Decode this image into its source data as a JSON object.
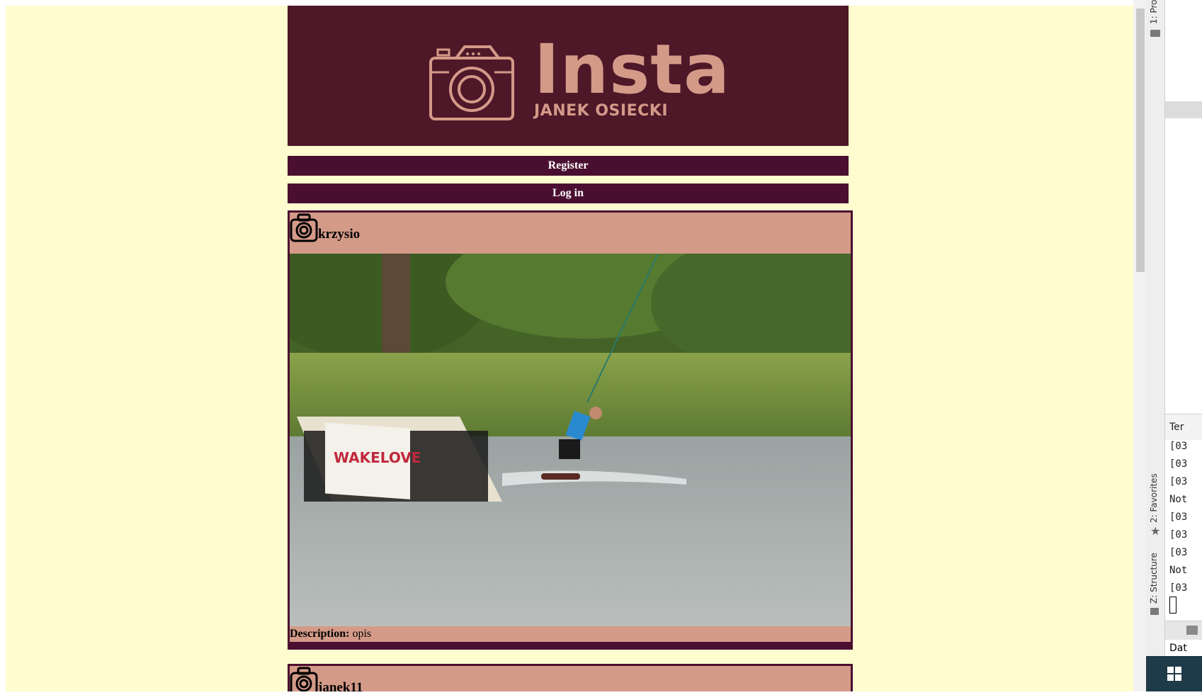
{
  "header": {
    "logo_title": "Insta",
    "logo_subtitle": "JANEK OSIECKI"
  },
  "nav": {
    "register_label": "Register",
    "login_label": "Log in"
  },
  "posts": [
    {
      "username": "krzysio",
      "description_label": "Description:",
      "description": "opis",
      "banner_text": "WAKELOVE"
    },
    {
      "username": "janek11"
    }
  ],
  "ide": {
    "tab_project": "1: Pro",
    "tab_favorites": "2: Favorites",
    "tab_structure": "Z: Structure",
    "terminal_title": "Ter",
    "terminal_lines": [
      "[03",
      "[03",
      "[03",
      "Not",
      "[03",
      "[03",
      "[03",
      "Not",
      "[03"
    ],
    "bottom_tab": "Dat"
  },
  "colors": {
    "page_bg": "#fffdd0",
    "banner_bg": "#4e1828",
    "nav_bg": "#4a0f30",
    "post_bg": "#d49a88",
    "logo_accent": "#d49a88"
  }
}
